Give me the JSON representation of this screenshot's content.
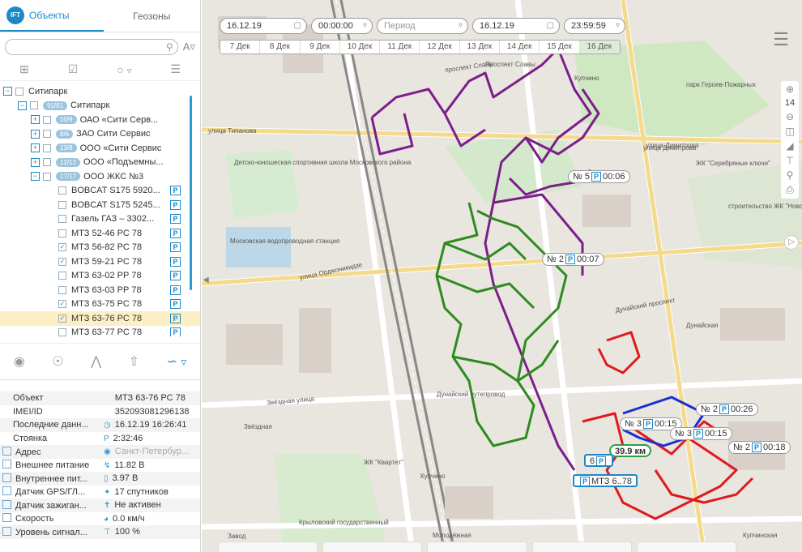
{
  "sidebar": {
    "logo_text": "IFT",
    "tabs": [
      {
        "label": "Объекты"
      },
      {
        "label": "Геозоны"
      }
    ],
    "search": {
      "placeholder": "",
      "value": ""
    },
    "tree": {
      "root": {
        "badge": "",
        "label": "Ситипарк"
      },
      "group": {
        "badge": "91/81",
        "label": "Ситипарк"
      },
      "subgroups": [
        {
          "badge": "10/9",
          "label": "ОАО «Сити Серв..."
        },
        {
          "badge": "8/6",
          "label": "ЗАО Сити Сервис"
        },
        {
          "badge": "13/8",
          "label": "ООО «Сити Сервис"
        },
        {
          "badge": "12/12",
          "label": "ООО «Подъемны..."
        },
        {
          "badge": "17/17",
          "label": "ООО ЖКС №3"
        }
      ],
      "vehicles": [
        {
          "label": "BOBCAT S175 5920...",
          "checked": false
        },
        {
          "label": "BOBCAT S175 5245...",
          "checked": false
        },
        {
          "label": "Газель ГАЗ – 3302...",
          "checked": false
        },
        {
          "label": "МТЗ 52-46 РС 78",
          "checked": false
        },
        {
          "label": "МТЗ 56-82 РС 78",
          "checked": true
        },
        {
          "label": "МТЗ 59-21 РС 78",
          "checked": true
        },
        {
          "label": "МТЗ 63-02 РР 78",
          "checked": false
        },
        {
          "label": "МТЗ 63-03 РР 78",
          "checked": false
        },
        {
          "label": "МТЗ 63-75 РС 78",
          "checked": true
        },
        {
          "label": "МТЗ 63-76 РС 78",
          "checked": true,
          "selected": true
        },
        {
          "label": "МТЗ 63-77 РС 78",
          "checked": false
        }
      ],
      "parking_mark": "P"
    },
    "properties": [
      {
        "key": "Объект",
        "value": "МТЗ 63-76 РС 78",
        "icon": "",
        "checkbox": false
      },
      {
        "key": "IMEI/ID",
        "value": "352093081296138",
        "icon": "",
        "checkbox": false
      },
      {
        "key": "Последние данн...",
        "value": "16.12.19 16:26:41",
        "icon": "clock-icon",
        "checkbox": false
      },
      {
        "key": "Стоянка",
        "value": "2:32:46",
        "icon": "parking-icon",
        "checkbox": false
      },
      {
        "key": "Адрес",
        "value": "Санкт-Петербур...",
        "icon": "pin-icon",
        "checkbox": true,
        "muted": true
      },
      {
        "key": "Внешнее питание",
        "value": "11.82 В",
        "icon": "plug-icon",
        "checkbox": true
      },
      {
        "key": "Внутреннее пит...",
        "value": "3.97 В",
        "icon": "battery-icon",
        "checkbox": true
      },
      {
        "key": "Датчик GPS/ГЛ...",
        "value": "17 спутников",
        "icon": "satellite-icon",
        "checkbox": true
      },
      {
        "key": "Датчик зажиган...",
        "value": "Не активен",
        "icon": "key-icon",
        "checkbox": true
      },
      {
        "key": "Скорость",
        "value": "0.0 км/ч",
        "icon": "speed-icon",
        "checkbox": true
      },
      {
        "key": "Уровень сигнал...",
        "value": "100 %",
        "icon": "signal-icon",
        "checkbox": true
      }
    ]
  },
  "map": {
    "toolbar": {
      "date_from": "16.12.19",
      "time_from": "00:00:00",
      "period_placeholder": "Период",
      "date_to": "16.12.19",
      "time_to": "23:59:59",
      "days": [
        "7 Дек",
        "8 Дек",
        "9 Дек",
        "10 Дек",
        "11 Дек",
        "12 Дек",
        "13 Дек",
        "14 Дек",
        "15 Дек",
        "16 Дек"
      ],
      "highlighted_day": "16 Дек"
    },
    "zoom_level": "14",
    "stops": [
      {
        "label": "№ 5",
        "time": "00:06"
      },
      {
        "label": "№ 2",
        "time": "00:07"
      },
      {
        "label": "№ 3",
        "time": "00:15"
      },
      {
        "label": "№ 3",
        "time": "00:15"
      },
      {
        "label": "№ 2",
        "time": "00:26"
      },
      {
        "label": "№ 2",
        "time": "00:18"
      }
    ],
    "distance": "39.9 км",
    "cluster": "6",
    "vehicle_label": "МТЗ 6..78",
    "places": [
      "Проспект Славы",
      "Купчино",
      "парк Героев-Пожарных",
      "улица Димитрова",
      "Дунайская",
      "Звёздная",
      "Купчино",
      "Дунайский путепровод",
      "Московская водопроводная станция",
      "Детско-юношеская спортивная школа Московского района",
      "улица Орджоникидзе",
      "Дунайский проспект",
      "Звёздная улица",
      "ЖК \"Квартет\"",
      "Крыловский государственный",
      "Молодёжная",
      "Купчинская",
      "Завод",
      "улица Типанова",
      "ЖК \"Серебряные ключи\"",
      "строительство ЖК \"Новое Купчино\"",
      "проспект Славы",
      "улица Димитрова"
    ],
    "route_colors": {
      "purple": "#7b1e8c",
      "green": "#2e8b1f",
      "red": "#e0191c",
      "blue": "#1a2fd0"
    }
  }
}
